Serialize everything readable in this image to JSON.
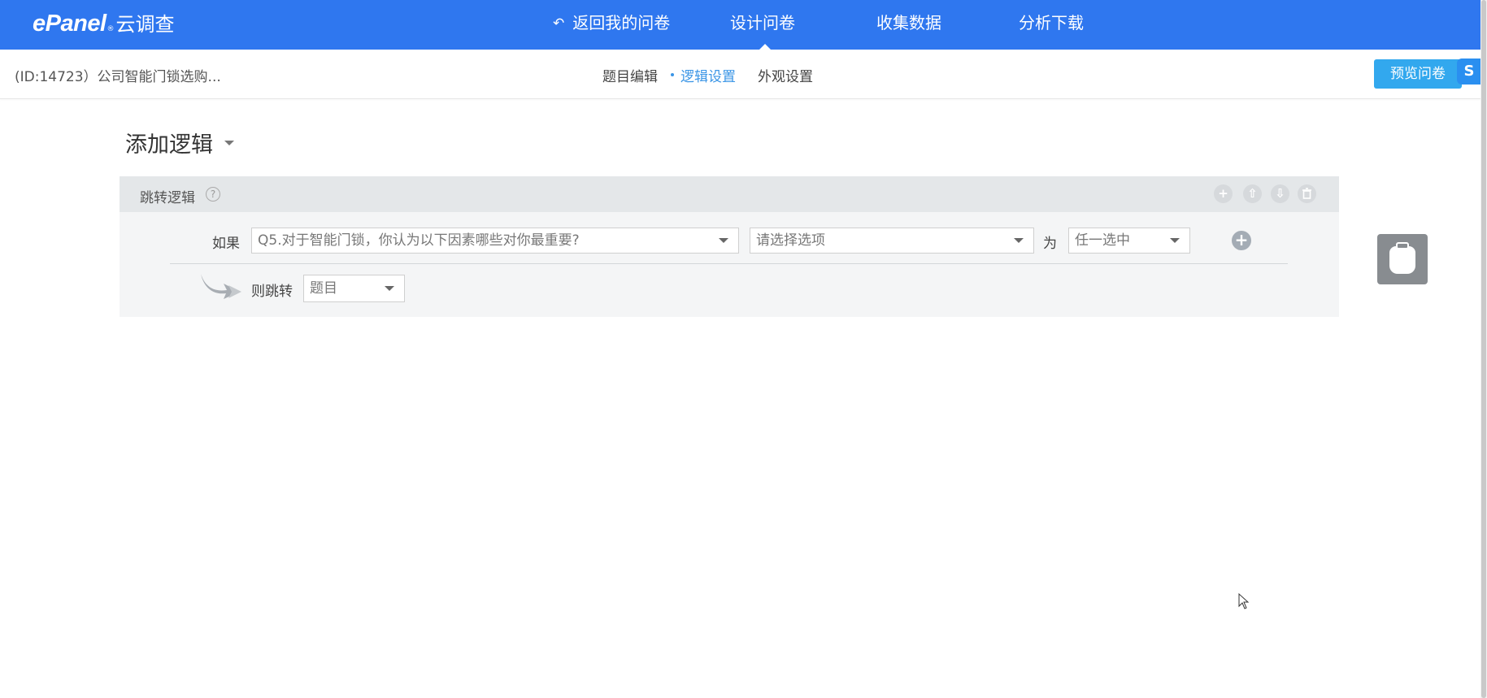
{
  "topbar": {
    "logo_brand": "ePanel",
    "logo_reg": "®",
    "logo_cn": "云调查",
    "nav": {
      "back_icon": "back-arrow-icon",
      "back_label": "返回我的问卷",
      "design_label": "设计问卷",
      "collect_label": "收集数据",
      "analyze_label": "分析下载"
    },
    "active_nav": "设计问卷",
    "color": "#2f77ef"
  },
  "subbar": {
    "survey_title": "(ID:14723）公司智能门锁选购...",
    "tabs": {
      "edit": "题目编辑",
      "logic": "逻辑设置",
      "appearance": "外观设置"
    },
    "active_tab": "逻辑设置",
    "preview_label": "预览问卷",
    "badge_icon": "s-logo-icon",
    "badge_glyph": "S",
    "accent_color": "#3a95e6"
  },
  "main": {
    "add_logic_label": "添加逻辑",
    "logic_panel": {
      "title": "跳转逻辑",
      "help_glyph": "?",
      "header_icons": {
        "add": "plus-circle-icon",
        "up": "arrow-up-circle-icon",
        "down": "arrow-down-circle-icon",
        "delete": "trash-icon"
      },
      "if_label": "如果",
      "question_select": "Q5.对于智能门锁，你认为以下因素哪些对你最重要?",
      "option_select_placeholder": "请选择选项",
      "is_label": "为",
      "condition_select": "任一选中",
      "add_condition_glyph": "+",
      "then_label": "则跳转",
      "jump_target_select": "题目"
    }
  },
  "floating": {
    "clipboard_icon": "clipboard-icon"
  }
}
